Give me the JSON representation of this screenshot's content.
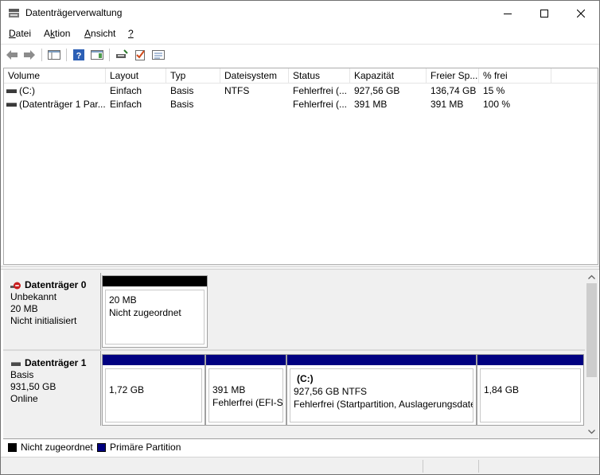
{
  "window": {
    "title": "Datenträgerverwaltung",
    "icon": "disk-management-icon"
  },
  "menu": [
    {
      "label": "Datei",
      "mnemonic": "D"
    },
    {
      "label": "Aktion",
      "mnemonic": "k"
    },
    {
      "label": "Ansicht",
      "mnemonic": "A"
    },
    {
      "label": "?",
      "mnemonic": "?"
    }
  ],
  "toolbar": [
    "back-arrow-icon",
    "forward-arrow-icon",
    "console-tree-icon",
    "help-icon",
    "show-action-pane-icon",
    "connect-disk-icon",
    "check-properties-icon",
    "settings-list-icon"
  ],
  "volume_list": {
    "columns": [
      "Volume",
      "Layout",
      "Typ",
      "Dateisystem",
      "Status",
      "Kapazität",
      "Freier Sp...",
      "% frei"
    ],
    "rows": [
      [
        "(C:)",
        "Einfach",
        "Basis",
        "NTFS",
        "Fehlerfrei (...",
        "927,56 GB",
        "136,74 GB",
        "15 %"
      ],
      [
        "(Datenträger 1 Par...",
        "Einfach",
        "Basis",
        "",
        "Fehlerfrei (...",
        "391 MB",
        "391 MB",
        "100 %"
      ]
    ]
  },
  "disks": [
    {
      "name": "Datenträger 0",
      "icon": "disk-uninitialized-icon",
      "type": "Unbekannt",
      "size": "20 MB",
      "state": "Nicht initialisiert",
      "partitions": [
        {
          "line1": "20 MB",
          "line2": "Nicht zugeordnet",
          "kind": "unallocated"
        }
      ]
    },
    {
      "name": "Datenträger 1",
      "icon": "disk-icon",
      "type": "Basis",
      "size": "931,50 GB",
      "state": "Online",
      "partitions": [
        {
          "title": "",
          "line1": "1,72 GB",
          "line2": "",
          "kind": "primary"
        },
        {
          "title": "",
          "line1": "391 MB",
          "line2": "Fehlerfrei (EFI-Sy",
          "kind": "primary"
        },
        {
          "title": "(C:)",
          "line1": "927,56 GB NTFS",
          "line2": "Fehlerfrei (Startpartition, Auslagerungsdate",
          "kind": "primary"
        },
        {
          "title": "",
          "line1": "1,84 GB",
          "line2": "",
          "kind": "primary"
        }
      ]
    }
  ],
  "legend": [
    {
      "label": "Nicht zugeordnet",
      "color": "#000000"
    },
    {
      "label": "Primäre Partition",
      "color": "#00008b"
    }
  ],
  "colors": {
    "unallocated": "#000000",
    "primary": "#000080"
  }
}
